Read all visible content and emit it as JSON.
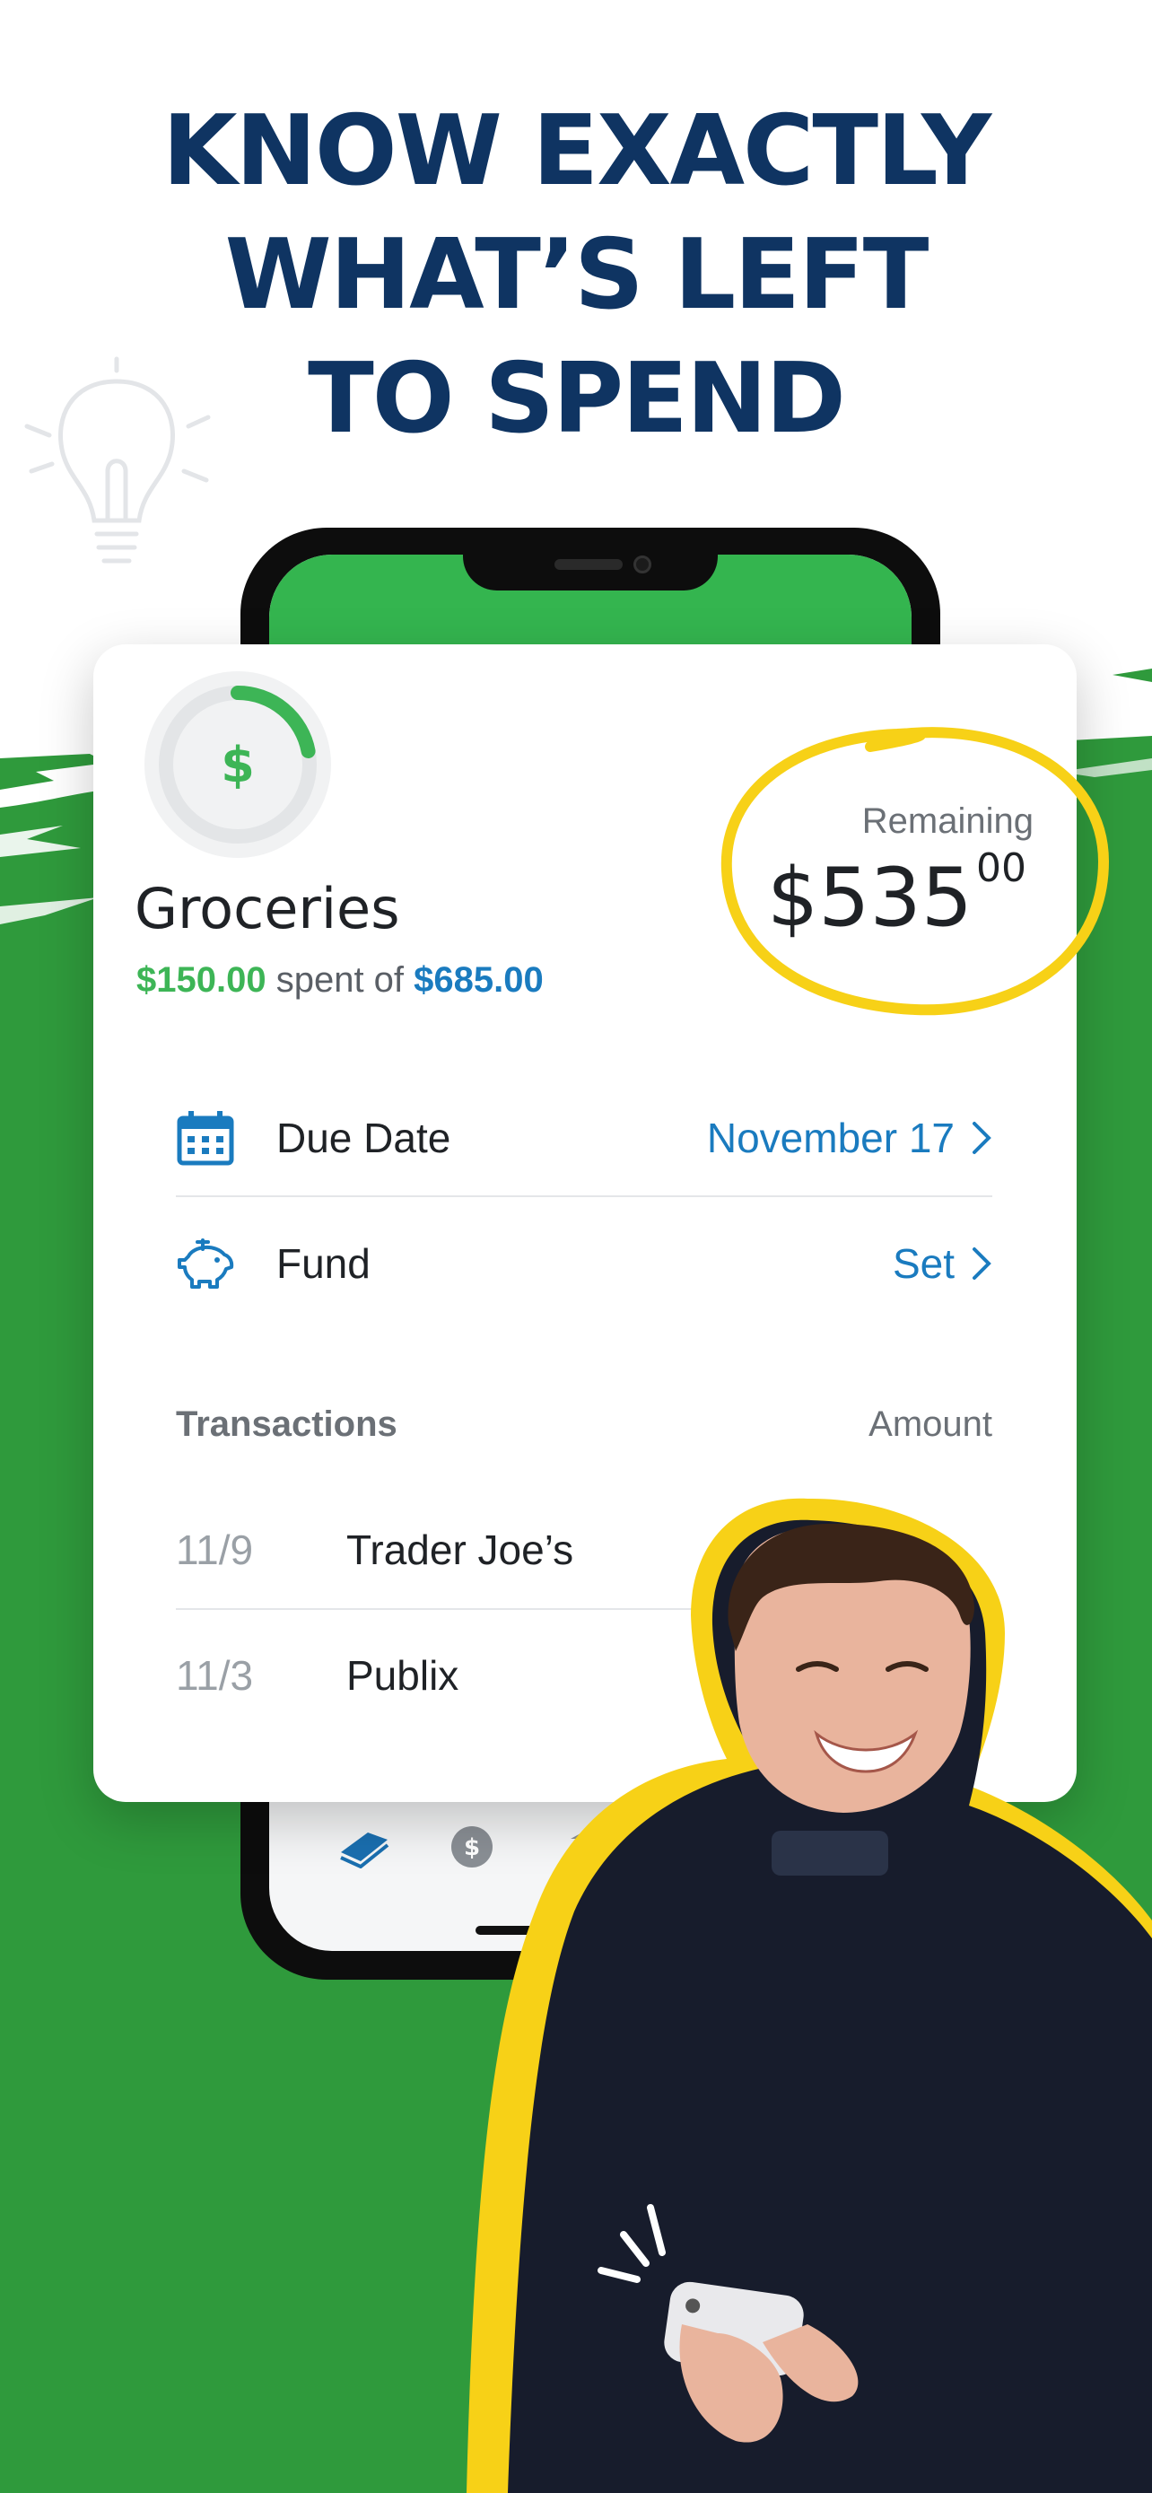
{
  "headline": {
    "line1": "KNOW EXACTLY",
    "line2": "WHAT’S LEFT",
    "line3": "TO SPEND"
  },
  "colors": {
    "headline": "#0f3462",
    "green": "#2f9a3c",
    "accent_green": "#3db556",
    "accent_blue": "#1a7bbf",
    "highlight_yellow": "#f7d117"
  },
  "budget": {
    "icon": "dollar-icon",
    "icon_symbol": "$",
    "progress_fraction": 0.22,
    "category": "Groceries",
    "spent": "$150.00",
    "spent_of_text": " spent of ",
    "planned": "$685.00",
    "remaining_label": "Remaining",
    "remaining_dollars": "$535",
    "remaining_cents": "00"
  },
  "rows": [
    {
      "icon": "calendar-icon",
      "label": "Due Date",
      "value": "November 17"
    },
    {
      "icon": "piggy-bank-icon",
      "label": "Fund",
      "value": "Set"
    }
  ],
  "transactions": {
    "header_left": "Transactions",
    "header_right": "Amount",
    "items": [
      {
        "date": "11/9",
        "name": "Trader Joe’s"
      },
      {
        "date": "11/3",
        "name": "Publix"
      }
    ]
  },
  "tabbar": [
    "budget-icon",
    "dollar-circle-icon",
    "bank-icon",
    "bar-chart-icon"
  ]
}
